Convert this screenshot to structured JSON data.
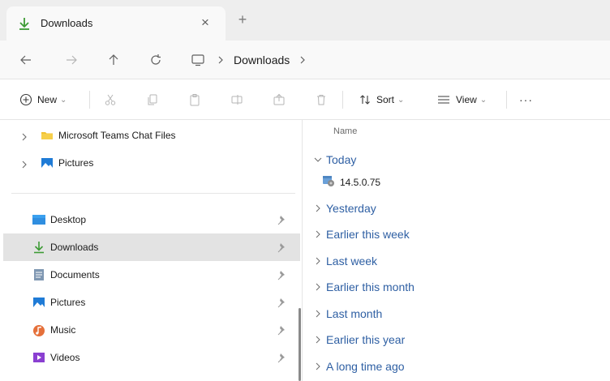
{
  "tab": {
    "title": "Downloads",
    "close_glyph": "×",
    "new_tab_glyph": "+"
  },
  "address": {
    "crumbs": [
      "Downloads"
    ]
  },
  "commands": {
    "new": "New",
    "sort": "Sort",
    "view": "View",
    "more": "···"
  },
  "nav": {
    "items": [
      {
        "label": "Microsoft Teams Chat Files",
        "icon": "folder-icon"
      },
      {
        "label": "Pictures",
        "icon": "pictures-icon"
      },
      {
        "label": "Desktop",
        "icon": "desktop-icon"
      },
      {
        "label": "Downloads",
        "icon": "downloads-icon"
      },
      {
        "label": "Documents",
        "icon": "documents-icon"
      },
      {
        "label": "Pictures",
        "icon": "pictures-icon"
      },
      {
        "label": "Music",
        "icon": "music-icon"
      },
      {
        "label": "Videos",
        "icon": "videos-icon"
      }
    ]
  },
  "content": {
    "column_name": "Name",
    "groups": [
      {
        "label": "Today",
        "expanded": true
      },
      {
        "label": "Yesterday"
      },
      {
        "label": "Earlier this week"
      },
      {
        "label": "Last week"
      },
      {
        "label": "Earlier this month"
      },
      {
        "label": "Last month"
      },
      {
        "label": "Earlier this year"
      },
      {
        "label": "A long time ago"
      }
    ],
    "files": [
      {
        "name": "14.5.0.75"
      }
    ]
  },
  "colors": {
    "accent": "#2e5fa3",
    "selected_row": "#e3e3e3",
    "download_green": "#3d9b35",
    "folder_yellow": "#f1c232"
  }
}
